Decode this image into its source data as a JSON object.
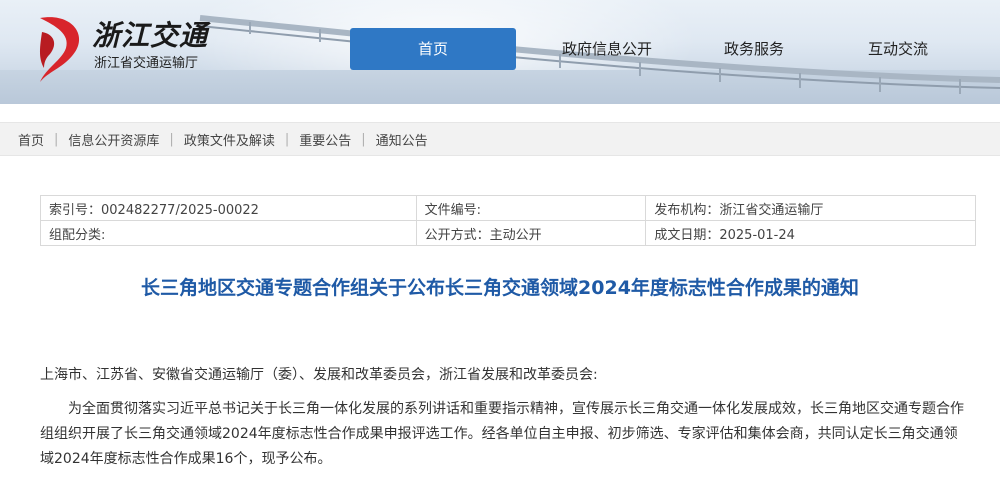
{
  "header": {
    "logo_name": "浙江交通",
    "logo_subtitle": "浙江省交通运输厅",
    "accent_color": "#2f78c5",
    "nav": [
      {
        "label": "首页",
        "active": true
      },
      {
        "label": "政府信息公开",
        "active": false
      },
      {
        "label": "政务服务",
        "active": false
      },
      {
        "label": "互动交流",
        "active": false
      }
    ]
  },
  "breadcrumb": [
    "首页",
    "信息公开资源库",
    "政策文件及解读",
    "重要公告",
    "通知公告"
  ],
  "info_table": {
    "index_no": "索引号：002482277/2025-00022",
    "doc_no": "文件编号:",
    "publisher": "发布机构：浙江省交通运输厅",
    "category": "组配分类:",
    "disclosure": "公开方式：主动公开",
    "date": "成文日期：2025-01-24"
  },
  "article": {
    "title": "长三角地区交通专题合作组关于公布长三角交通领域2024年度标志性合作成果的通知",
    "title_color": "#1f5aa6",
    "salutation": "上海市、江苏省、安徽省交通运输厅（委）、发展和改革委员会，浙江省发展和改革委员会:",
    "paragraph": "为全面贯彻落实习近平总书记关于长三角一体化发展的系列讲话和重要指示精神，宣传展示长三角交通一体化发展成效，长三角地区交通专题合作组组织开展了长三角交通领域2024年度标志性合作成果申报评选工作。经各单位自主申报、初步筛选、专家评估和集体会商，共同认定长三角交通领域2024年度标志性合作成果16个，现予公布。"
  }
}
